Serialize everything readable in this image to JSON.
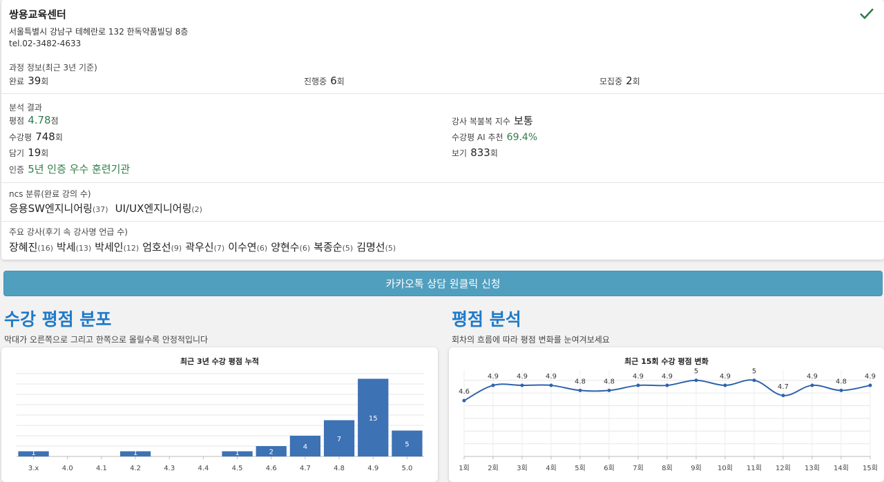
{
  "center": {
    "name": "쌍용교육센터",
    "address": "서울특별시 강남구 테헤란로 132 한독약품빌딩 8층",
    "tel": "tel.02-3482-4633"
  },
  "course_info": {
    "label": "과정 정보(최근 3년 기준)",
    "completed_label": "완료",
    "completed_value": "39",
    "completed_unit": "회",
    "ongoing_label": "진행중",
    "ongoing_value": "6",
    "ongoing_unit": "회",
    "recruiting_label": "모집중",
    "recruiting_value": "2",
    "recruiting_unit": "회"
  },
  "analysis": {
    "label": "분석 결과",
    "rating_label": "평점",
    "rating_value": "4.78",
    "rating_unit": "점",
    "reviews_label": "수강평",
    "reviews_value": "748",
    "reviews_unit": "회",
    "saves_label": "담기",
    "saves_value": "19",
    "saves_unit": "회",
    "cert_label": "인증",
    "cert_value": "5년 인증 우수 훈련기관",
    "luck_label": "강사 복불복 지수",
    "luck_value": "보통",
    "ai_label": "수강평 AI 추천",
    "ai_value": "69.4%",
    "views_label": "보기",
    "views_value": "833",
    "views_unit": "회"
  },
  "ncs": {
    "label": "ncs 분류(완료 강의 수)",
    "items": [
      {
        "name": "응용SW엔지니어링",
        "count": "(37)"
      },
      {
        "name": "UI/UX엔지니어링",
        "count": "(2)"
      }
    ]
  },
  "instructors": {
    "label": "주요 강사(후기 속 강사명 언급 수)",
    "items": [
      {
        "name": "장혜진",
        "count": "(16)"
      },
      {
        "name": "박세",
        "count": "(13)"
      },
      {
        "name": "박세인",
        "count": "(12)"
      },
      {
        "name": "엄호선",
        "count": "(9)"
      },
      {
        "name": "곽우신",
        "count": "(7)"
      },
      {
        "name": "이수연",
        "count": "(6)"
      },
      {
        "name": "양현수",
        "count": "(6)"
      },
      {
        "name": "복종순",
        "count": "(5)"
      },
      {
        "name": "김명선",
        "count": "(5)"
      }
    ]
  },
  "kakao_button": "카카오톡 상담 원클릭 신청",
  "dist_section": {
    "title": "수강 평점 분포",
    "desc": "막대가 오른쪽으로 그리고 한쪽으로 몰릴수록 안정적입니다"
  },
  "trend_section": {
    "title": "평점 분석",
    "desc": "회차의 흐름에 따라 평점 변화를 눈여겨보세요"
  },
  "colors": {
    "accent": "#1f7ac9",
    "green": "#2e7d4a",
    "bar": "#3d72b4",
    "button": "#519fbf"
  },
  "chart_data": [
    {
      "type": "bar",
      "title": "최근 3년 수강 평점 누적",
      "categories": [
        "3.x",
        "4.0",
        "4.1",
        "4.2",
        "4.3",
        "4.4",
        "4.5",
        "4.6",
        "4.7",
        "4.8",
        "4.9",
        "5.0"
      ],
      "values": [
        1,
        0,
        0,
        1,
        0,
        0,
        1,
        2,
        4,
        7,
        15,
        5
      ],
      "ylim": [
        0,
        16
      ],
      "grid": true
    },
    {
      "type": "line",
      "title": "최근 15회 수강 평점 변화",
      "categories": [
        "1회",
        "2회",
        "3회",
        "4회",
        "5회",
        "6회",
        "7회",
        "8회",
        "9회",
        "10회",
        "11회",
        "12회",
        "13회",
        "14회",
        "15회"
      ],
      "values": [
        4.6,
        4.9,
        4.9,
        4.9,
        4.8,
        4.8,
        4.9,
        4.9,
        5,
        4.9,
        5,
        4.7,
        4.9,
        4.8,
        4.9
      ],
      "ylim": [
        3.5,
        5.2
      ],
      "grid": true
    }
  ]
}
